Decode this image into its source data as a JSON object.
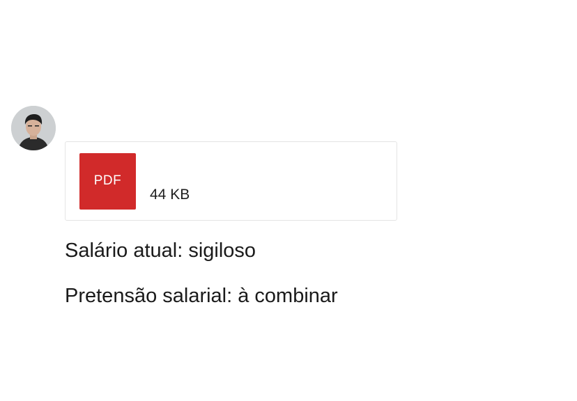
{
  "attachment": {
    "icon_label": "PDF",
    "icon": "pdf-file-icon",
    "file_size": "44 KB",
    "icon_color": "#d12a2a"
  },
  "message": {
    "lines": [
      "Salário atual: sigiloso",
      "Pretensão salarial: à combinar"
    ]
  }
}
